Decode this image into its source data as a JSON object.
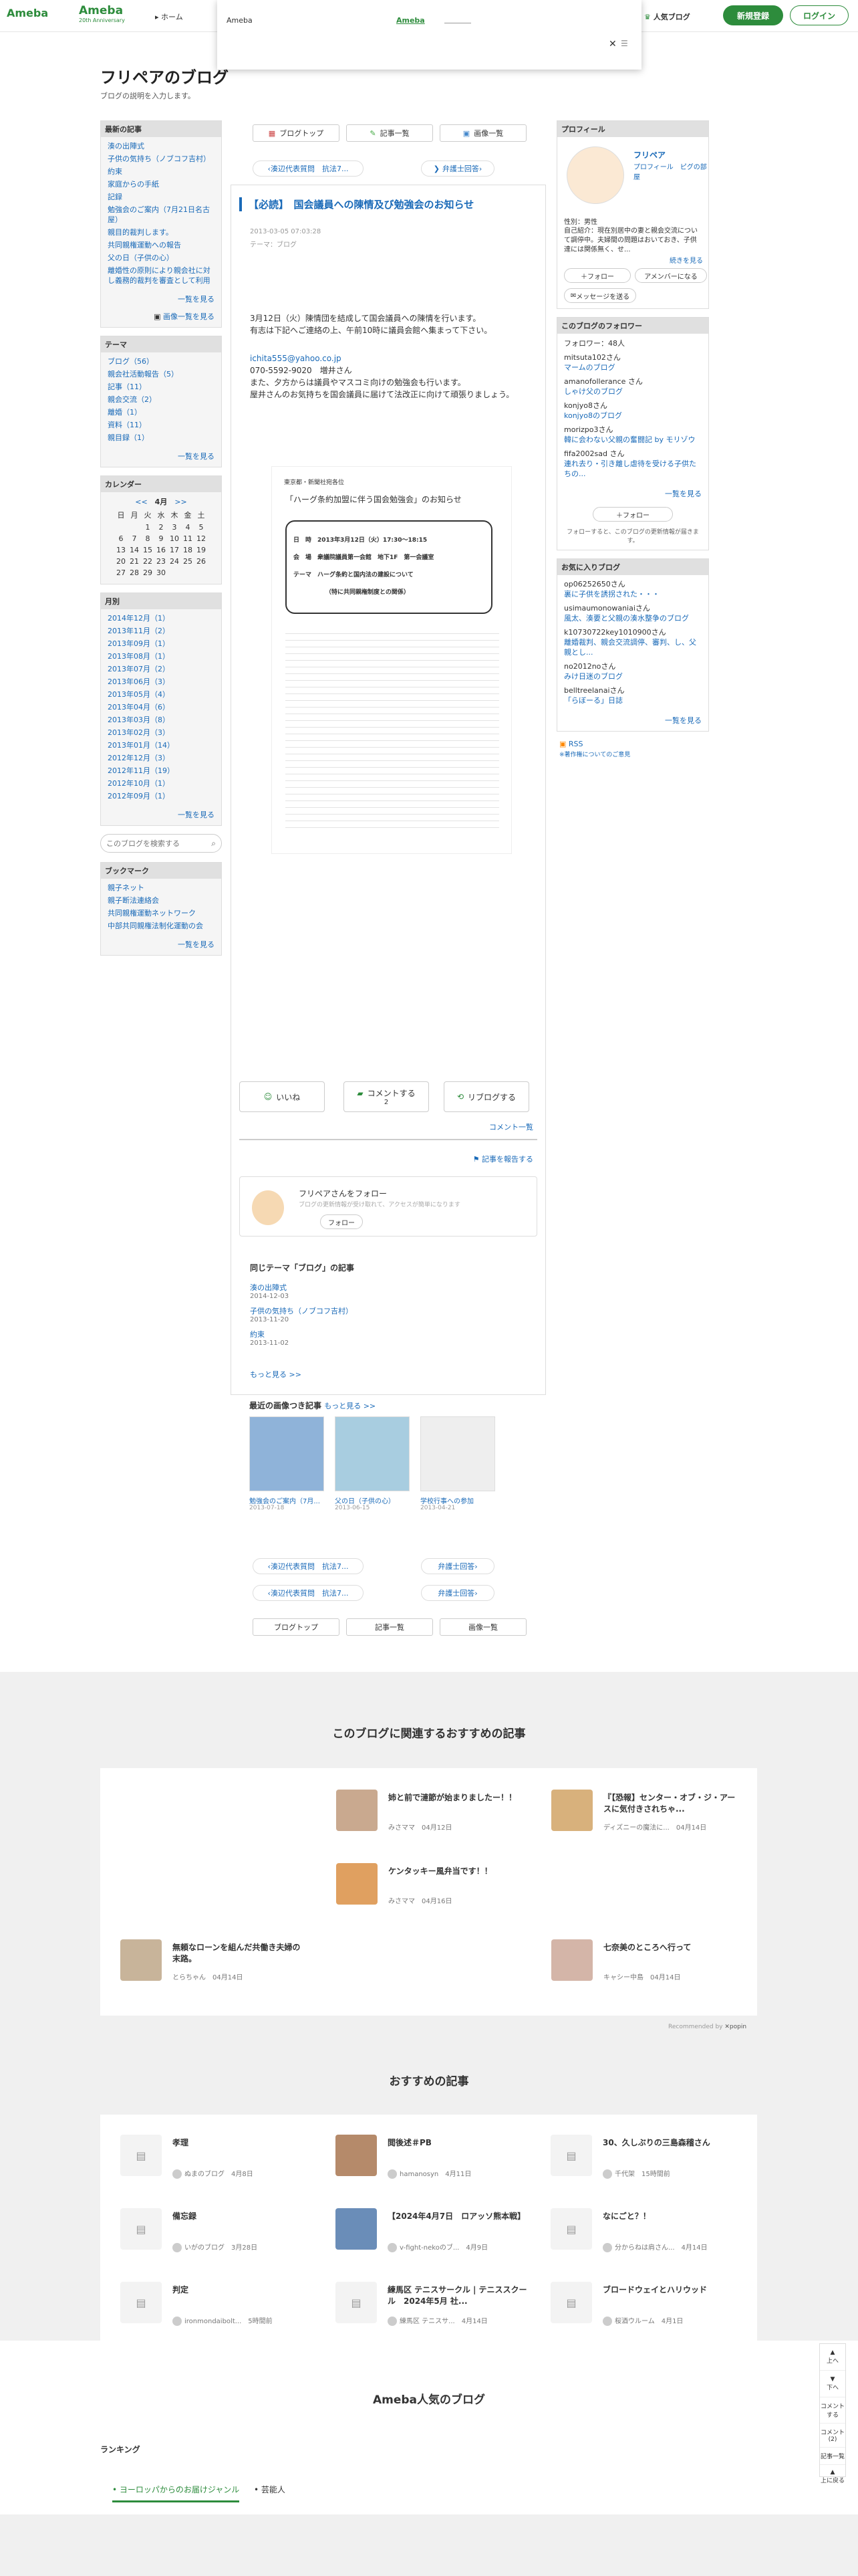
{
  "header": {
    "logo": "Ameba",
    "anniv_logo": "Ameba",
    "anniv_sub": "20th Anniversary",
    "home": "ホーム",
    "popular": "人気ブログ",
    "signup": "新規登録",
    "login": "ログイン"
  },
  "popup": {
    "title": "Ameba",
    "link": "Ameba"
  },
  "blog": {
    "title": "フリペアのブログ",
    "desc": "ブログの説明を入力します。"
  },
  "topnav": {
    "blogtop": "ブログトップ",
    "entries": "記事一覧",
    "images": "画像一覧"
  },
  "prevnext": {
    "prev": "湊辺代表質問　抗法7...",
    "next": "弁護士回答"
  },
  "article": {
    "title": "【必読】　国会議員への陳情及び勉強会のお知らせ",
    "date": "2013-03-05 07:03:28",
    "theme": "テーマ：ブログ",
    "p1": "3月12日（火）陳情団を結成して国会議員への陳情を行います。",
    "p2": "有志は下記へご連絡の上、午前10時に議員会館へ集まって下さい。",
    "email": "ichita555@yahoo.co.jp",
    "tel": "070-5592-9020　増井さん",
    "p3": "また、夕方からは議員やマスコミ向けの勉強会も行います。",
    "p4": "屋井さんのお気持ちを国会議員に届けて法改正に向けて頑張りましょう。",
    "doc_head": "東京都・新聞社宛各位",
    "doc_title": "「ハーグ条約加盟に伴う国会勉強会」のお知らせ",
    "doc_date": "日　時　2013年3月12日（火）17:30〜18:15",
    "doc_place": "会　場　衆議院議員第一会館　地下1F　第一会議室",
    "doc_theme": "テーマ　ハーグ条約と国内法の建設について",
    "doc_sub": "（特に共同親権制度との関係）"
  },
  "actions": {
    "like": "いいね",
    "comment": "コメントする",
    "comment_count": "2",
    "reblog": "リブログする",
    "comment_list": "コメント一覧",
    "report": "記事を報告する"
  },
  "follow": {
    "name": "フリペアさんをフォロー",
    "desc": "ブログの更新情報が受け取れて、アクセスが簡単になります",
    "btn": "フォロー"
  },
  "same_theme": {
    "title": "同じテーマ「ブログ」の記事",
    "items": [
      {
        "t": "湊の出陣式",
        "d": "2014-12-03"
      },
      {
        "t": "子供の気持ち（ノブコフ吉村）",
        "d": "2013-11-20"
      },
      {
        "t": "約束",
        "d": "2013-11-02"
      }
    ],
    "more": "もっと見る >>"
  },
  "img_entries": {
    "title": "最近の画像つき記事",
    "more": "もっと見る >>",
    "items": [
      {
        "t": "勉強会のご案内（7月...",
        "d": "2013-07-18"
      },
      {
        "t": "父の日（子供の心）",
        "d": "2013-06-15"
      },
      {
        "t": "学校行事への参加",
        "d": "2013-04-21"
      }
    ]
  },
  "left": {
    "recent": {
      "title": "最新の記事",
      "items": [
        "湊の出陣式",
        "子供の気持ち（ノブコフ吉村）",
        "約束",
        "家庭からの手紙",
        "記録",
        "勉強会のご案内（7月21日名古屋）",
        "親目的裁判します。",
        "共同親権運動への報告",
        "父の日（子供の心）",
        "離婚性の原則により親会社に対し義務的裁判を審査として利用"
      ],
      "more": "一覧を見る",
      "img_more": "画像一覧を見る"
    },
    "theme": {
      "title": "テーマ",
      "items": [
        "ブログ（56）",
        "親会社活動報告（5）",
        "記事（11）",
        "親会交流（2）",
        "離婚（1）",
        "資料（11）",
        "親目録（1）"
      ],
      "more": "一覧を見る"
    },
    "calendar": {
      "title": "カレンダー",
      "month": "4月",
      "dow": [
        "日",
        "月",
        "火",
        "水",
        "木",
        "金",
        "土"
      ],
      "rows": [
        [
          "",
          "",
          "1",
          "2",
          "3",
          "4",
          "5"
        ],
        [
          "6",
          "7",
          "8",
          "9",
          "10",
          "11",
          "12"
        ],
        [
          "13",
          "14",
          "15",
          "16",
          "17",
          "18",
          "19"
        ],
        [
          "20",
          "21",
          "22",
          "23",
          "24",
          "25",
          "26"
        ],
        [
          "27",
          "28",
          "29",
          "30",
          "",
          "",
          ""
        ]
      ]
    },
    "monthly": {
      "title": "月別",
      "items": [
        "2014年12月（1）",
        "2013年11月（2）",
        "2013年09月（1）",
        "2013年08月（1）",
        "2013年07月（2）",
        "2013年06月（3）",
        "2013年05月（4）",
        "2013年04月（6）",
        "2013年03月（8）",
        "2013年02月（3）",
        "2013年01月（14）",
        "2012年12月（3）",
        "2012年11月（19）",
        "2012年10月（1）",
        "2012年09月（1）"
      ],
      "more": "一覧を見る"
    },
    "search": {
      "placeholder": "このブログを検索する"
    },
    "bookmark": {
      "title": "ブックマーク",
      "items": [
        "親子ネット",
        "親子断法連絡会",
        "共同親権運動ネットワーク",
        "中部共同親権法制化運動の会"
      ],
      "more": "一覧を見る"
    }
  },
  "right": {
    "profile": {
      "title": "プロフィール",
      "name": "フリペア",
      "links": "プロフィール　ピグの部屋",
      "sex": "性別：男性",
      "desc": "自己紹介：現在別居中の妻と親会交流について調停中。夫婦間の問題はおいておき、子供達には関係無く、せ...",
      "more": "続きを見る",
      "follow": "フォロー",
      "member": "アメンバーになる",
      "msg": "メッセージを送る"
    },
    "followers": {
      "title": "このブログのフォロワー",
      "count": "フォロワー：48人",
      "items": [
        {
          "u": "mitsuta102さん",
          "b": "マームのブログ"
        },
        {
          "u": "amanofollerance さん",
          "b": "しゃけ父のブログ"
        },
        {
          "u": "konjyo8さん",
          "b": "konjyo8のブログ"
        },
        {
          "u": "morizpo3さん",
          "b": "韓に会わない父親の奮闘記 by モリゾウ"
        },
        {
          "u": "fifa2002sad さん",
          "b": "連れ去り・引き離し虐待を受ける子供たちの..."
        }
      ],
      "more": "一覧を見る",
      "btn": "フォロー",
      "note": "フォローすると、このブログの更新情報が届きます。"
    },
    "favs": {
      "title": "お気に入りブログ",
      "items": [
        {
          "u": "op06252650さん",
          "b": "裏に子供を誘拐された・・・"
        },
        {
          "u": "usimaumonowaniaiさん",
          "b": "風太、湊要と父親の湊水整争のブログ"
        },
        {
          "u": "k10730722key1010900さん",
          "b": "離婚裁判、親会交流調停、審判、し、父親とし..."
        },
        {
          "u": "no2012noさん",
          "b": "みけ日迷のブログ"
        },
        {
          "u": "belltreelanaiさん",
          "b": "「らぼーる」日誌"
        }
      ],
      "more": "一覧を見る"
    },
    "rss": "RSS",
    "rss_sub": "※著作権についてのご意見"
  },
  "reco": {
    "title": "このブログに関連するおすすめの記事",
    "items": [
      {
        "t": "姉と前で漣節が始まりましたー！！",
        "a": "みさママ",
        "d": "04月12日"
      },
      {
        "t": "『【恐報】センター・オブ・ジ・アースに気付きされちゃ...",
        "a": "ディズニーの魔法に...",
        "d": "04月14日"
      },
      {
        "t": "ケンタッキー風弁当です！！",
        "a": "みさママ",
        "d": "04月16日"
      },
      {
        "t": "無頼なローンを組んだ共働き夫婦の末路。",
        "a": "とらちゃん",
        "d": "04月14日"
      },
      {
        "t": "七奈美のところへ行って",
        "a": "キャシー中島",
        "d": "04月14日"
      }
    ],
    "powered": "Recommended by"
  },
  "osusume": {
    "title": "おすすめの記事",
    "items": [
      {
        "t": "孝理",
        "a": "ぬまのブログ",
        "d": "4月8日"
      },
      {
        "t": "閲後述＃PB",
        "a": "hamanosyn",
        "d": "4月11日"
      },
      {
        "t": "30、久しぶりの三島森稽さん",
        "a": "千代架",
        "d": "15時間前"
      },
      {
        "t": "備忘録",
        "a": "いがのブログ",
        "d": "3月28日"
      },
      {
        "t": "【2024年4月7日　ロアッソ熊本戦】",
        "a": "v-fight-nekoのブ...",
        "d": "4月9日"
      },
      {
        "t": "なにごと？！",
        "a": "分からねは肩さん...",
        "d": "4月14日"
      },
      {
        "t": "判定",
        "a": "ironmondaibolt...",
        "d": "5時間前"
      },
      {
        "t": "練馬区 テニスサークル | テニススクール　2024年5月 社...",
        "a": "練馬区 テニスサ...",
        "d": "4月14日"
      },
      {
        "t": "ブロードウェイとハリウッド",
        "a": "桜酒ウルーム",
        "d": "4月1日"
      }
    ]
  },
  "popular": {
    "title": "Ameba人気のブログ",
    "ranking": "ランキング",
    "tab1": "ヨーロッパからのお届けジャンル",
    "tab2": "芸能人"
  },
  "floatnav": {
    "up": "上へ",
    "down": "下へ",
    "comment": "コメントする",
    "comment2": "コメント(2)",
    "entries": "記事一覧",
    "top": "上に戻る"
  }
}
